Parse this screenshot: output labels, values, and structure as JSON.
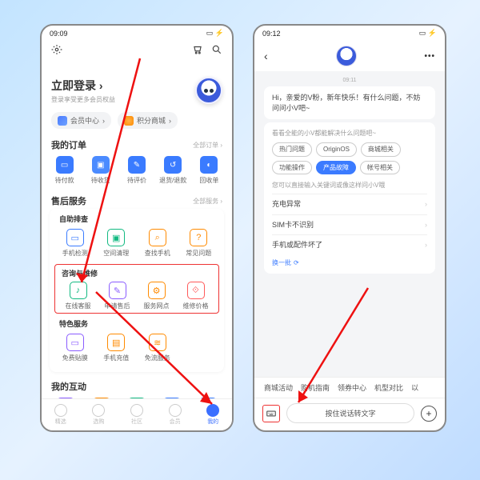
{
  "left": {
    "status_time": "09:09",
    "login_title": "立即登录",
    "login_sub": "登录享受更多会员权益",
    "pills": {
      "member": "会员中心",
      "points": "积分商城"
    },
    "orders": {
      "title": "我的订单",
      "more": "全部订单",
      "items": [
        "待付款",
        "待收货",
        "待评价",
        "退货/退款",
        "回收单"
      ]
    },
    "service": {
      "title": "售后服务",
      "more": "全部服务"
    },
    "self_check": {
      "title": "自助排查",
      "items": [
        "手机检测",
        "空间清理",
        "查找手机",
        "常见问题"
      ]
    },
    "consult": {
      "title": "咨询与维修",
      "items": [
        "在线客服",
        "申请售后",
        "服务网点",
        "维修价格"
      ]
    },
    "special": {
      "title": "特色服务",
      "items": [
        "免费贴膜",
        "手机充值",
        "免流服务"
      ]
    },
    "interact": {
      "title": "我的互动"
    },
    "tabs": [
      "精选",
      "选购",
      "社区",
      "会员",
      "我的"
    ]
  },
  "right": {
    "status_time": "09:12",
    "timestamp": "09:11",
    "greeting": "Hi，亲爱的V粉，新年快乐！有什么问题，不妨问问小V吧~",
    "panel_title": "看看全能的小V都能解决什么问题吧~",
    "chips": [
      "热门问题",
      "OriginOS",
      "商城相关",
      "功能操作",
      "产品故障",
      "帐号相关"
    ],
    "chip_active_index": 4,
    "hint": "您可以直接输入关键词或像这样问小V哦",
    "questions": [
      "充电异常",
      "SIM卡不识别",
      "手机或配件坏了"
    ],
    "refresh": "换一批",
    "bottom_chips": [
      "商城活动",
      "购机指南",
      "领券中心",
      "机型对比",
      "以"
    ],
    "voice_label": "按住说话转文字"
  }
}
